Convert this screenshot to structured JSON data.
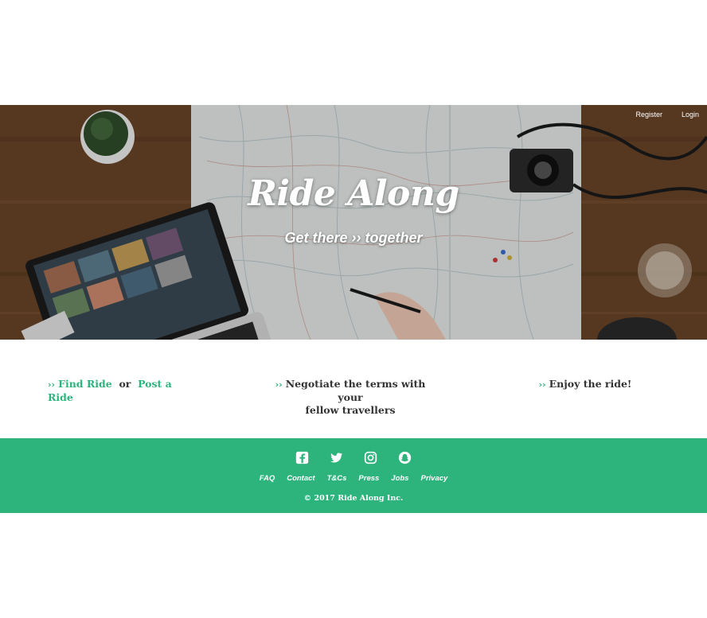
{
  "nav": {
    "register": "Register",
    "login": "Login"
  },
  "hero": {
    "title": "Ride Along",
    "tagline": "Get there ›› together"
  },
  "steps": {
    "chevron": "››",
    "step1": {
      "find_ride": "Find Ride",
      "or": "or",
      "post_ride": "Post a Ride"
    },
    "step2": {
      "line1": "Negotiate the terms with your",
      "line2": "fellow travellers"
    },
    "step3": {
      "text": "Enjoy the ride!"
    }
  },
  "footer": {
    "social": [
      "facebook-icon",
      "twitter-icon",
      "instagram-icon",
      "snapchat-icon"
    ],
    "links": [
      "FAQ",
      "Contact",
      "T&Cs",
      "Press",
      "Jobs",
      "Privacy"
    ],
    "copyright": "© 2017 Ride Along Inc."
  },
  "colors": {
    "brand_green": "#2db47d",
    "text_dark": "#333333",
    "white": "#ffffff"
  }
}
